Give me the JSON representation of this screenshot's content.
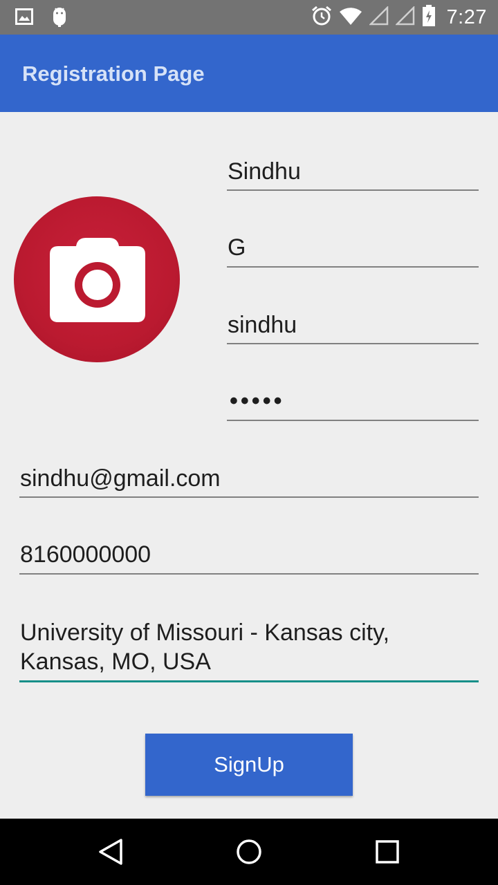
{
  "status_bar": {
    "time": "7:27",
    "icons": [
      "image-notification-icon",
      "android-debug-icon",
      "alarm-icon",
      "wifi-icon",
      "signal-icon",
      "signal-icon",
      "battery-icon"
    ]
  },
  "app_bar": {
    "title": "Registration Page"
  },
  "form": {
    "avatar_icon": "camera-icon",
    "first_name": "Sindhu",
    "last_name": "G",
    "username": "sindhu",
    "password_mask": "•••••",
    "email": "sindhu@gmail.com",
    "phone": "8160000000",
    "address_line1": "University of Missouri - Kansas city,",
    "address_line2": "Kansas, MO, USA",
    "signup_label": "SignUp"
  },
  "colors": {
    "primary": "#3366cc",
    "accent": "#168f88",
    "avatar": "#bb1a30",
    "background": "#eeeeee"
  },
  "nav_bar": {
    "icons": [
      "back-icon",
      "home-icon",
      "recents-icon"
    ]
  }
}
